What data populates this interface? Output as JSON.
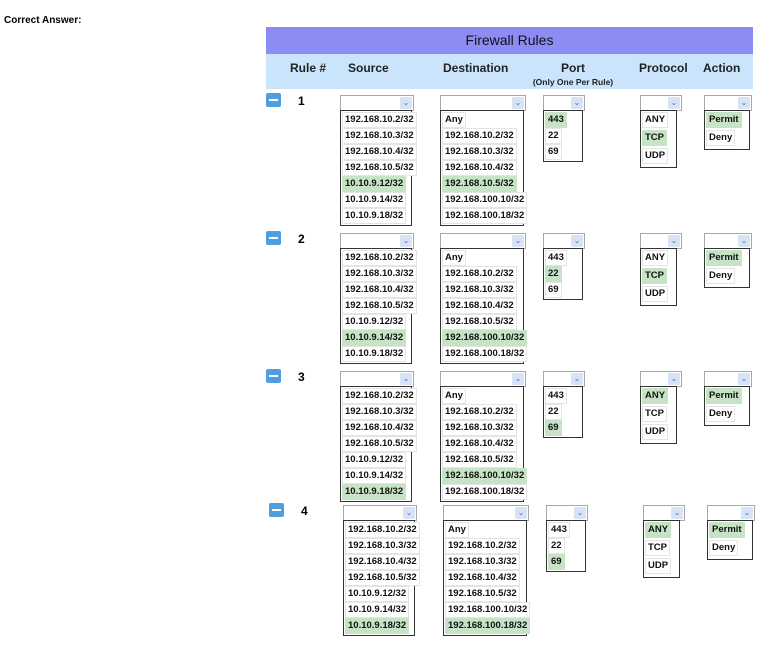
{
  "page_label": "Correct Answer:",
  "panel": {
    "title": "Firewall Rules",
    "headers": {
      "rule": "Rule #",
      "source": "Source",
      "destination": "Destination",
      "port": "Port",
      "port_sub": "(Only One Per Rule)",
      "protocol": "Protocol",
      "action": "Action"
    }
  },
  "colors": {
    "title_bar": "#8c8cf5",
    "header_bar": "#c9e4fb",
    "selected_option": "#c6e3c6",
    "minus_button": "#4f9fe0"
  },
  "rules": [
    {
      "number": "1",
      "source": [
        "192.168.10.2/32",
        "192.168.10.3/32",
        "192.168.10.4/32",
        "192.168.10.5/32",
        "10.10.9.12/32",
        "10.10.9.14/32",
        "10.10.9.18/32"
      ],
      "source_selected": "10.10.9.12/32",
      "destination": [
        "Any",
        "192.168.10.2/32",
        "192.168.10.3/32",
        "192.168.10.4/32",
        "192.168.10.5/32",
        "192.168.100.10/32",
        "192.168.100.18/32"
      ],
      "destination_selected": "192.168.10.5/32",
      "port": [
        "443",
        "22",
        "69"
      ],
      "port_selected": "443",
      "protocol": [
        "ANY",
        "TCP",
        "UDP"
      ],
      "protocol_selected": "TCP",
      "action": [
        "Permit",
        "Deny"
      ],
      "action_selected": "Permit"
    },
    {
      "number": "2",
      "source": [
        "192.168.10.2/32",
        "192.168.10.3/32",
        "192.168.10.4/32",
        "192.168.10.5/32",
        "10.10.9.12/32",
        "10.10.9.14/32",
        "10.10.9.18/32"
      ],
      "source_selected": "10.10.9.14/32",
      "destination": [
        "Any",
        "192.168.10.2/32",
        "192.168.10.3/32",
        "192.168.10.4/32",
        "192.168.10.5/32",
        "192.168.100.10/32",
        "192.168.100.18/32"
      ],
      "destination_selected": "192.168.100.10/32",
      "port": [
        "443",
        "22",
        "69"
      ],
      "port_selected": "22",
      "protocol": [
        "ANY",
        "TCP",
        "UDP"
      ],
      "protocol_selected": "TCP",
      "action": [
        "Permit",
        "Deny"
      ],
      "action_selected": "Permit"
    },
    {
      "number": "3",
      "source": [
        "192.168.10.2/32",
        "192.168.10.3/32",
        "192.168.10.4/32",
        "192.168.10.5/32",
        "10.10.9.12/32",
        "10.10.9.14/32",
        "10.10.9.18/32"
      ],
      "source_selected": "10.10.9.18/32",
      "destination": [
        "Any",
        "192.168.10.2/32",
        "192.168.10.3/32",
        "192.168.10.4/32",
        "192.168.10.5/32",
        "192.168.100.10/32",
        "192.168.100.18/32"
      ],
      "destination_selected": "192.168.100.10/32",
      "port": [
        "443",
        "22",
        "69"
      ],
      "port_selected": "69",
      "protocol": [
        "ANY",
        "TCP",
        "UDP"
      ],
      "protocol_selected": "ANY",
      "action": [
        "Permit",
        "Deny"
      ],
      "action_selected": "Permit"
    },
    {
      "number": "4",
      "source": [
        "192.168.10.2/32",
        "192.168.10.3/32",
        "192.168.10.4/32",
        "192.168.10.5/32",
        "10.10.9.12/32",
        "10.10.9.14/32",
        "10.10.9.18/32"
      ],
      "source_selected": "10.10.9.18/32",
      "destination": [
        "Any",
        "192.168.10.2/32",
        "192.168.10.3/32",
        "192.168.10.4/32",
        "192.168.10.5/32",
        "192.168.100.10/32",
        "192.168.100.18/32"
      ],
      "destination_selected": "192.168.100.18/32",
      "port": [
        "443",
        "22",
        "69"
      ],
      "port_selected": "69",
      "protocol": [
        "ANY",
        "TCP",
        "UDP"
      ],
      "protocol_selected": "ANY",
      "action": [
        "Permit",
        "Deny"
      ],
      "action_selected": "Permit"
    }
  ]
}
